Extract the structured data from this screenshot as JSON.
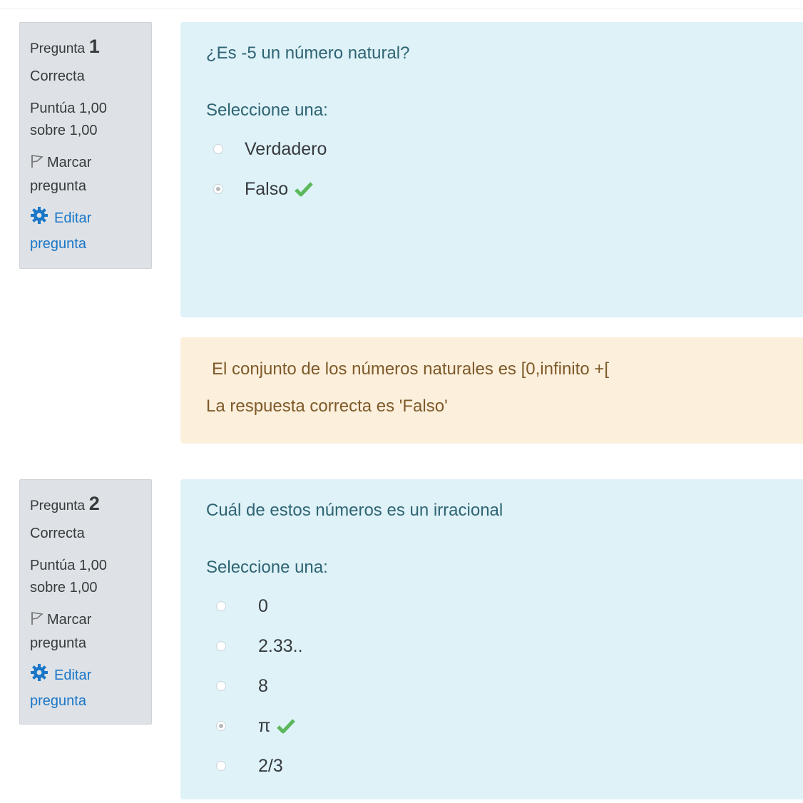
{
  "questions": [
    {
      "label": "Pregunta",
      "number": "1",
      "state": "Correcta",
      "grade_line1": "Puntúa 1,00",
      "grade_line2": "sobre 1,00",
      "flag_line1": "Marcar",
      "flag_line2": "pregunta",
      "edit_line1": "Editar",
      "edit_line2": "pregunta",
      "text": "¿Es -5 un número natural?",
      "prompt": "Seleccione una:",
      "options": [
        {
          "label": "Verdadero",
          "selected": false,
          "correct": false
        },
        {
          "label": "Falso",
          "selected": true,
          "correct": true
        }
      ],
      "feedback": "El conjunto de los números naturales es [0,infinito +[",
      "right_answer": "La respuesta correcta es 'Falso'"
    },
    {
      "label": "Pregunta",
      "number": "2",
      "state": "Correcta",
      "grade_line1": "Puntúa 1,00",
      "grade_line2": "sobre 1,00",
      "flag_line1": "Marcar",
      "flag_line2": "pregunta",
      "edit_line1": "Editar",
      "edit_line2": "pregunta",
      "text": "Cuál de estos números es un irracional",
      "prompt": "Seleccione una:",
      "options": [
        {
          "label": "0",
          "selected": false,
          "correct": false
        },
        {
          "label": "2.33..",
          "selected": false,
          "correct": false
        },
        {
          "label": "8",
          "selected": false,
          "correct": false
        },
        {
          "label": "π",
          "selected": true,
          "correct": true
        },
        {
          "label": "2/3",
          "selected": false,
          "correct": false
        }
      ]
    }
  ],
  "colors": {
    "info_bg": "#dee2e6",
    "question_bg": "#def2f8",
    "outcome_bg": "#fcefdc",
    "link": "#1a76c7",
    "correct_check": "#5cb85c"
  },
  "icons": {
    "flag": "flag-icon",
    "edit": "gear-icon",
    "correct": "check-icon"
  }
}
